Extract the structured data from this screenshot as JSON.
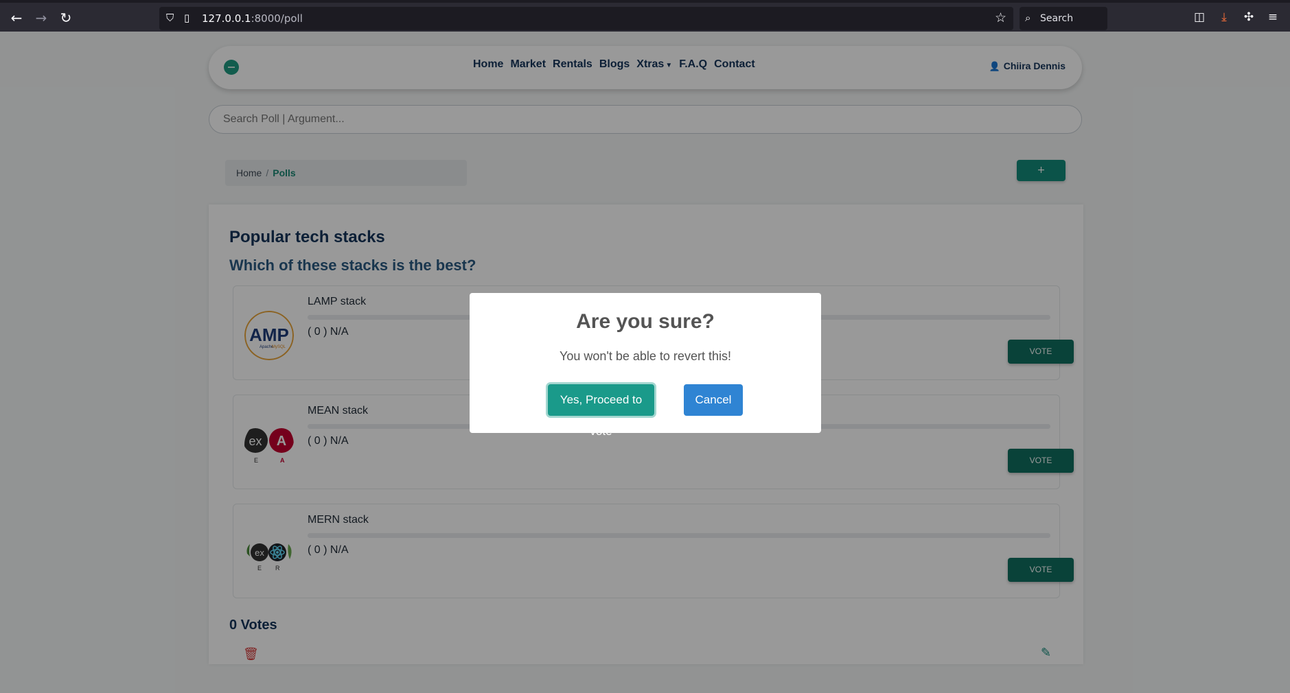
{
  "browser": {
    "url_host": "127.0.0.1",
    "url_path": ":8000/poll",
    "search_placeholder": "Search"
  },
  "navbar": {
    "links": [
      "Home",
      "Market",
      "Rentals",
      "Blogs",
      "Xtras",
      "F.A.Q",
      "Contact"
    ],
    "user_name": "Chiira Dennis"
  },
  "search": {
    "placeholder": "Search Poll | Argument..."
  },
  "breadcrumb": {
    "home": "Home",
    "separator": "/",
    "current": "Polls"
  },
  "add_button_label": "+",
  "poll": {
    "title": "Popular tech stacks",
    "question": "Which of these stacks is the best?",
    "options": [
      {
        "name": "LAMP stack",
        "count_text": "( 0 ) N/A",
        "vote_label": "VOTE",
        "progress": 0
      },
      {
        "name": "MEAN stack",
        "count_text": "( 0 ) N/A",
        "vote_label": "VOTE",
        "progress": 0
      },
      {
        "name": "MERN stack",
        "count_text": "( 0 ) N/A",
        "vote_label": "VOTE",
        "progress": 0
      }
    ],
    "total_votes": "0 Votes"
  },
  "modal": {
    "title": "Are you sure?",
    "text": "You won't be able to revert this!",
    "confirm_label": "Yes, Proceed to vote",
    "cancel_label": "Cancel"
  },
  "colors": {
    "brand": "#138a7a",
    "confirm": "#1a9a8a",
    "cancel": "#2f84d3",
    "delete": "#d43a3a"
  }
}
